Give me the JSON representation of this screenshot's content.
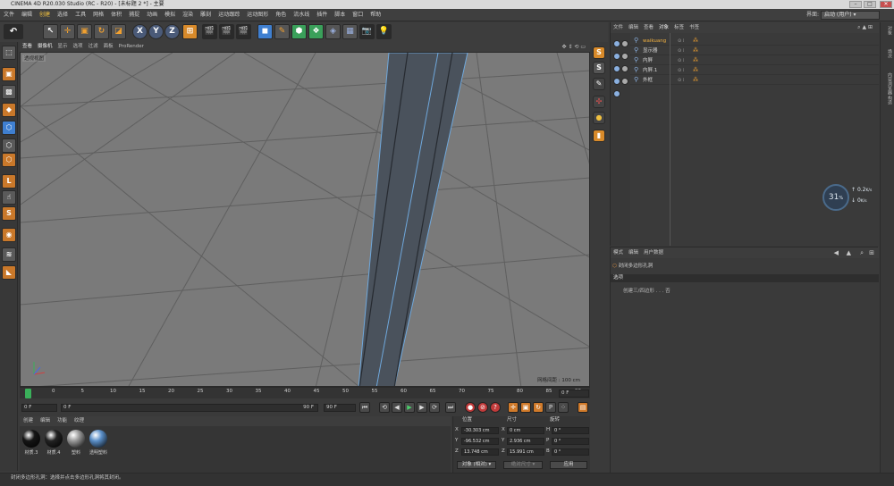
{
  "window": {
    "title": "CINEMA 4D R20.030 Studio (RC - R20) - [未标题 2 *] - 主要",
    "min_label": "–",
    "max_label": "□",
    "close_label": "✕"
  },
  "menubar": {
    "items": [
      "文件",
      "编辑",
      "创建",
      "选择",
      "工具",
      "网格",
      "体积",
      "捕捉",
      "动画",
      "模拟",
      "渲染",
      "雕刻",
      "运动跟踪",
      "运动图形",
      "角色",
      "流水线",
      "插件",
      "脚本",
      "窗口",
      "帮助"
    ],
    "highlight_index": 2,
    "layout_label": "界面:",
    "layout_value": "启动 (用户)"
  },
  "toolbar": {
    "undo_icon": "undo-icon",
    "axis_x": "X",
    "axis_y": "Y",
    "axis_z": "Z"
  },
  "viewport": {
    "menu": [
      "查看",
      "摄像机",
      "显示",
      "选项",
      "过滤",
      "面板",
      "ProRender"
    ],
    "camera_label": "透视视图",
    "grid_spacing": "网格间距 : 100 cm",
    "colors": {
      "background": "#7a7a7a",
      "object": "#4a525c",
      "edge": "#6fa8dc"
    }
  },
  "timeline": {
    "ticks": [
      "0",
      "5",
      "10",
      "15",
      "20",
      "25",
      "30",
      "35",
      "40",
      "45",
      "50",
      "55",
      "60",
      "65",
      "70",
      "75",
      "80",
      "85",
      "90"
    ],
    "current_frame": "0 F"
  },
  "transport": {
    "start_field": "0 F",
    "preview_start": "0 F",
    "preview_end": "90 F",
    "end_field": "90 F"
  },
  "materials": {
    "menu": [
      "创建",
      "编辑",
      "功能",
      "纹理"
    ],
    "items": [
      {
        "name": "材质.3",
        "color": "#151515"
      },
      {
        "name": "材质.4",
        "color": "#222222"
      },
      {
        "name": "塑料",
        "color": "#9a9a9a"
      },
      {
        "name": "透明塑料",
        "color": "#5b8fc8"
      }
    ]
  },
  "coordinates": {
    "headers": {
      "position": "位置",
      "size": "尺寸",
      "rotation": "旋转"
    },
    "rows": [
      {
        "axis": "X",
        "pos": "-30.303 cm",
        "size_axis": "X",
        "size": "0 cm",
        "rot_axis": "H",
        "rot": "0 °"
      },
      {
        "axis": "Y",
        "pos": "-96.532 cm",
        "size_axis": "Y",
        "size": "2.936 cm",
        "rot_axis": "P",
        "rot": "0 °"
      },
      {
        "axis": "Z",
        "pos": "13.748 cm",
        "size_axis": "Z",
        "size": "15.991 cm",
        "rot_axis": "B",
        "rot": "0 °"
      }
    ],
    "mode_select": "对象 (相对)",
    "size_select": "绝对尺寸",
    "apply_button": "应用"
  },
  "status": {
    "text": "封闭多边形孔洞：选择并点击多边形孔洞将其封闭。"
  },
  "object_manager": {
    "menu": [
      "文件",
      "编辑",
      "查看",
      "对象",
      "标签",
      "书签"
    ],
    "highlight_index": 3,
    "objects": [
      {
        "name": "waikuang",
        "selected": true
      },
      {
        "name": "显示器",
        "selected": false
      },
      {
        "name": "内屏",
        "selected": false
      },
      {
        "name": "内屏.1",
        "selected": false
      },
      {
        "name": "外框",
        "selected": false
      }
    ]
  },
  "hud": {
    "fps": "31",
    "fps_suffix": "%",
    "up_value": "0.2",
    "up_unit": "K/s",
    "down_value": "0",
    "down_unit": "K/s"
  },
  "attributes": {
    "menu": [
      "模式",
      "编辑",
      "用户数据"
    ],
    "tool_name": "封闭多边形孔洞",
    "tab": "选项",
    "option_label": "创建三/四边形",
    "option_value": "否"
  },
  "right_tabs": [
    "对象",
    "场次",
    "内容浏览器",
    "构造"
  ]
}
